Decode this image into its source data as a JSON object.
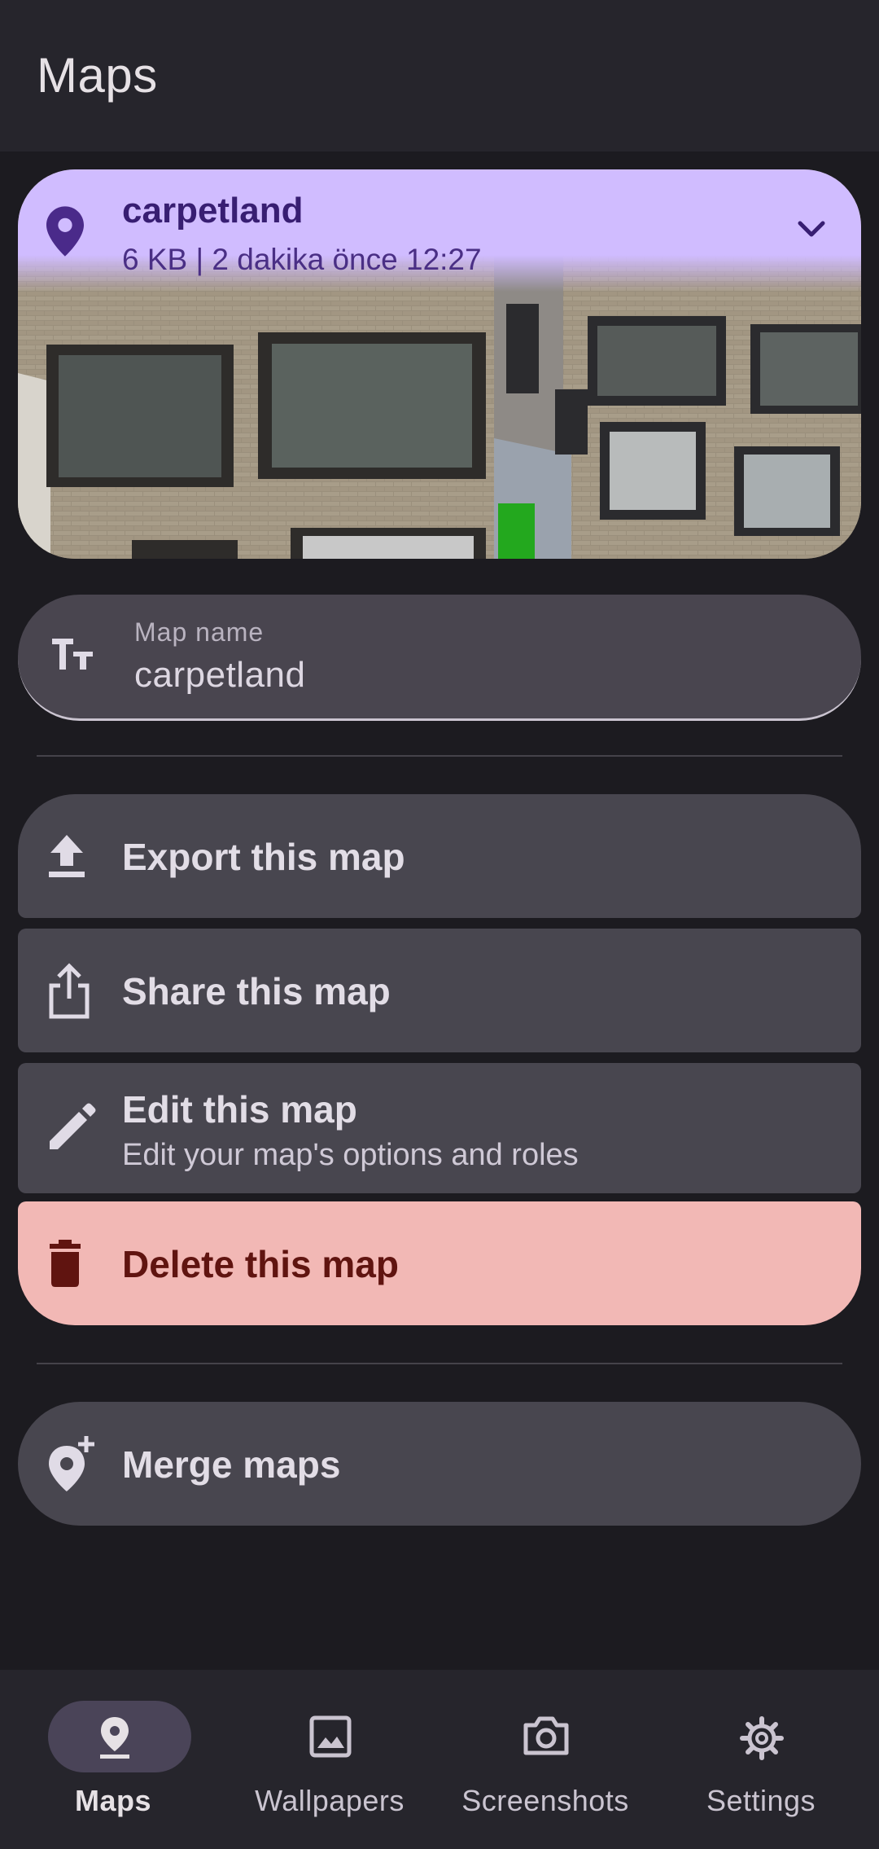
{
  "app_bar": {
    "title": "Maps"
  },
  "map_card": {
    "name": "carpetland",
    "meta": "6 KB | 2 dakika önce 12:27",
    "icon": "location-pin-icon",
    "expand_icon": "chevron-down-icon"
  },
  "name_field": {
    "label": "Map name",
    "value": "carpetland",
    "icon": "text-fields-icon"
  },
  "actions": {
    "export": {
      "label": "Export this map",
      "icon": "upload-icon"
    },
    "share": {
      "label": "Share this map",
      "icon": "share-icon"
    },
    "edit": {
      "label": "Edit this map",
      "sublabel": "Edit your map's options and roles",
      "icon": "pencil-icon"
    },
    "delete": {
      "label": "Delete this map",
      "icon": "trash-icon"
    },
    "merge": {
      "label": "Merge maps",
      "icon": "add-location-icon"
    }
  },
  "bottom_nav": {
    "items": [
      {
        "label": "Maps",
        "icon": "location-pin-icon",
        "active": true
      },
      {
        "label": "Wallpapers",
        "icon": "image-icon",
        "active": false
      },
      {
        "label": "Screenshots",
        "icon": "camera-icon",
        "active": false
      },
      {
        "label": "Settings",
        "icon": "gear-icon",
        "active": false
      }
    ]
  },
  "colors": {
    "background": "#1c1b20",
    "surface": "#26252c",
    "card_header": "#d0bcff",
    "danger": "#f2b8b5",
    "danger_text": "#601410"
  }
}
